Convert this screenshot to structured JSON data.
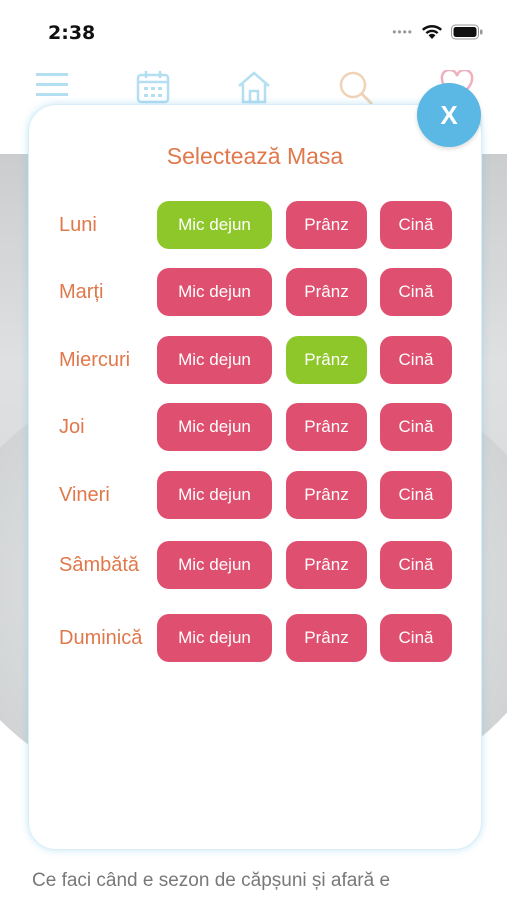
{
  "status": {
    "time": "2:38"
  },
  "nav": {
    "icons": [
      "menu-icon",
      "calendar-icon",
      "home-icon",
      "search-icon",
      "heart-icon"
    ]
  },
  "article": {
    "snippet": "Ce faci când e sezon de căpșuni și afară e"
  },
  "modal": {
    "title": "Selectează Masa",
    "close_label": "X",
    "meal_labels": {
      "breakfast": "Mic dejun",
      "lunch": "Prânz",
      "dinner": "Cină"
    },
    "days": [
      {
        "name": "Luni",
        "selected": "breakfast"
      },
      {
        "name": "Marți",
        "selected": ""
      },
      {
        "name": "Miercuri",
        "selected": "lunch"
      },
      {
        "name": "Joi",
        "selected": ""
      },
      {
        "name": "Vineri",
        "selected": ""
      },
      {
        "name": "Sâmbătă",
        "selected": ""
      },
      {
        "name": "Duminică",
        "selected": ""
      }
    ]
  },
  "colors": {
    "accent_orange": "#e0784c",
    "button_pink": "#df4f6f",
    "button_selected_green": "#8ec72a",
    "close_blue": "#5bb7e3"
  }
}
